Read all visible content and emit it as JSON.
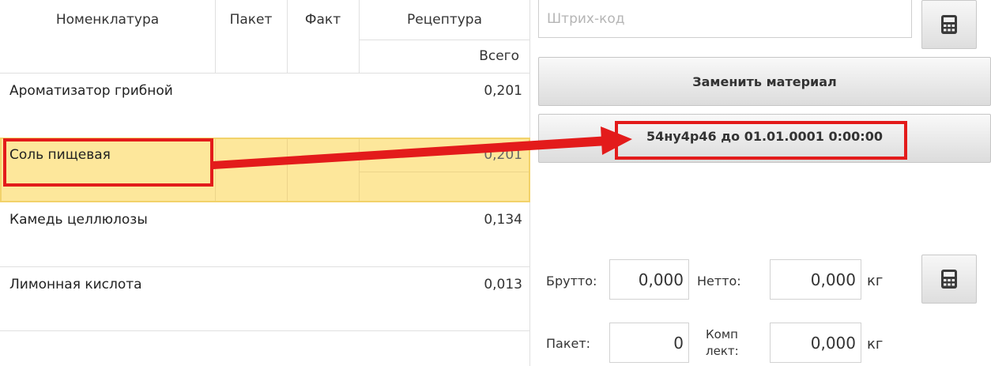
{
  "table": {
    "headers": {
      "nomenclature": "Номенклатура",
      "package": "Пакет",
      "fact": "Факт",
      "recipe": "Рецептура",
      "total": "Всего"
    },
    "rows": [
      {
        "name": "Ароматизатор грибной",
        "total": "0,201",
        "selected": false
      },
      {
        "name": "Соль пищевая",
        "total": "0,201",
        "selected": true
      },
      {
        "name": "Камедь целлюлозы",
        "total": "0,134",
        "selected": false
      },
      {
        "name": "Лимонная кислота",
        "total": "0,013",
        "selected": false
      }
    ]
  },
  "barcode": {
    "placeholder": "Штрих-код",
    "value": ""
  },
  "buttons": {
    "replace_material": "Заменить материал",
    "batch": "54ну4р46 до 01.01.0001 0:00:00"
  },
  "weights": {
    "gross_label": "Брутто:",
    "gross_value": "0,000",
    "net_label": "Нетто:",
    "net_value": "0,000",
    "net_unit": "кг",
    "package_label": "Пакет:",
    "package_value": "0",
    "kit_label_line1": "Комп",
    "kit_label_line2": "лект:",
    "kit_value": "0,000",
    "kit_unit": "кг"
  },
  "icons": {
    "barcode_calc": "calculator-icon",
    "weight_calc": "calculator-icon"
  },
  "colors": {
    "selected_row": "#fde79b",
    "annotation": "#e31b1b"
  }
}
